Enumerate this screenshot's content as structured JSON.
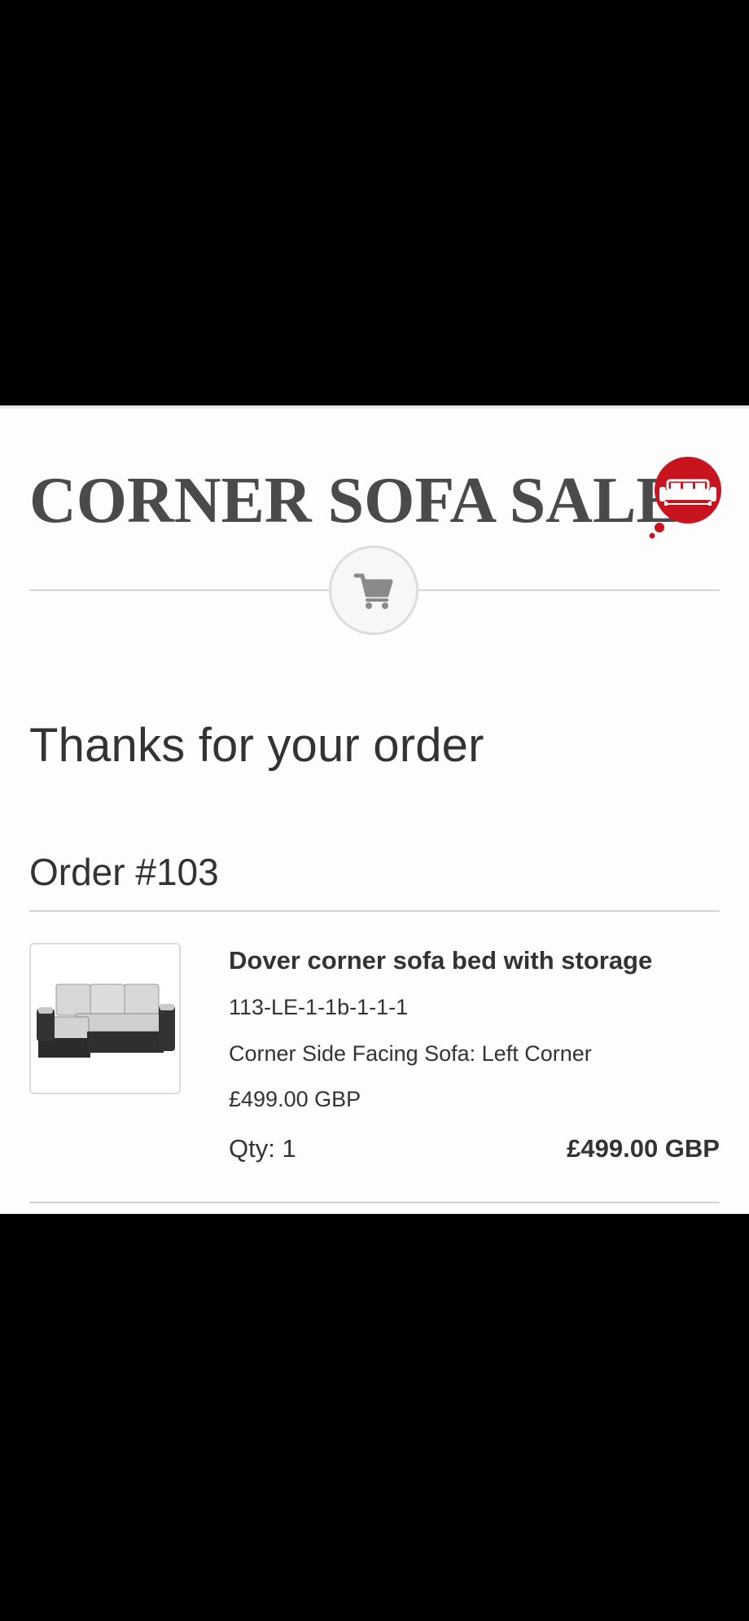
{
  "brand": {
    "name": "CORNER SOFA SALE",
    "accent_color": "#c8141e",
    "text_color": "#4a4a4a"
  },
  "header": {
    "cart_icon": "shopping-cart-icon"
  },
  "page": {
    "headline": "Thanks for your order",
    "order_number": "Order #103"
  },
  "order_item": {
    "title": "Dover corner sofa bed with storage",
    "sku": "113-LE-1-1b-1-1-1",
    "variant": "Corner Side Facing Sofa: Left Corner",
    "unit_price": "£499.00 GBP",
    "quantity": "Qty: 1",
    "line_total": "£499.00 GBP",
    "image_icon": "sofa-image"
  }
}
